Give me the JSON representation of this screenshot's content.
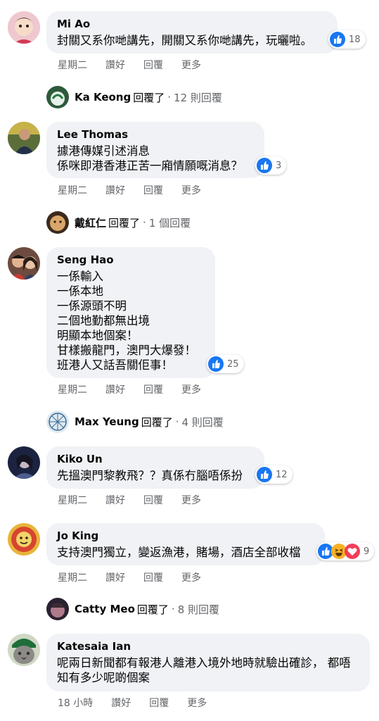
{
  "comments": [
    {
      "author": "Mi Ao",
      "text": "封關又系你哋講先，開關又系你哋講先，玩曬啦。",
      "reaction_count": "18",
      "actions": [
        "星期二",
        "讚好",
        "回覆",
        "更多"
      ]
    },
    {
      "author": "Lee Thomas",
      "text": "據港傳媒引述消息\n係咪即港香港正苦一廂情願嘅消息？",
      "reaction_count": "3",
      "actions": [
        "星期二",
        "讚好",
        "回覆",
        "更多"
      ]
    },
    {
      "author": "Seng Hao",
      "text": "一係輸入\n一係本地\n一係源頭不明\n二個地勤都無出境\n明顯本地個案！\n甘樣搬龍門，澳門大爆發！\n班港人又話吾關佢事！",
      "reaction_count": "25",
      "actions": [
        "星期二",
        "讚好",
        "回覆",
        "更多"
      ]
    },
    {
      "author": "Kiko Un",
      "text": "先搵澳門黎教飛？？真係冇腦唔係扮",
      "reaction_count": "12",
      "actions": [
        "星期二",
        "讚好",
        "回覆",
        "更多"
      ]
    },
    {
      "author": "Jo King",
      "text": "支持澳門獨立，變返漁港，賭場，酒店全部收檔",
      "reaction_count": "9",
      "actions": [
        "星期二",
        "讚好",
        "回覆",
        "更多"
      ]
    },
    {
      "author": "Katesaia Ian",
      "text": "呢兩日新聞都有報港人離港入境外地時就驗出確診， 都唔知有多少呢啲個案",
      "actions": [
        "18 小時",
        "讚好",
        "回覆",
        "更多"
      ]
    }
  ],
  "replies": [
    {
      "name": "Ka Keong",
      "verb": "回覆了",
      "sep": "·",
      "count": "12 則回覆"
    },
    {
      "name": "戴紅仁",
      "verb": "回覆了",
      "sep": "·",
      "count": "1 個回覆"
    },
    {
      "name": "Max Yeung",
      "verb": "回覆了",
      "sep": "·",
      "count": "4 則回覆"
    },
    {
      "name": "Catty Meo",
      "verb": "回覆了",
      "sep": "·",
      "count": "8 則回覆"
    }
  ],
  "colors": {
    "bubble": "#f0f2f5",
    "like": "#1877f2",
    "haha": "#f7b125",
    "love": "#f33e58",
    "secondary_text": "#65676b"
  }
}
